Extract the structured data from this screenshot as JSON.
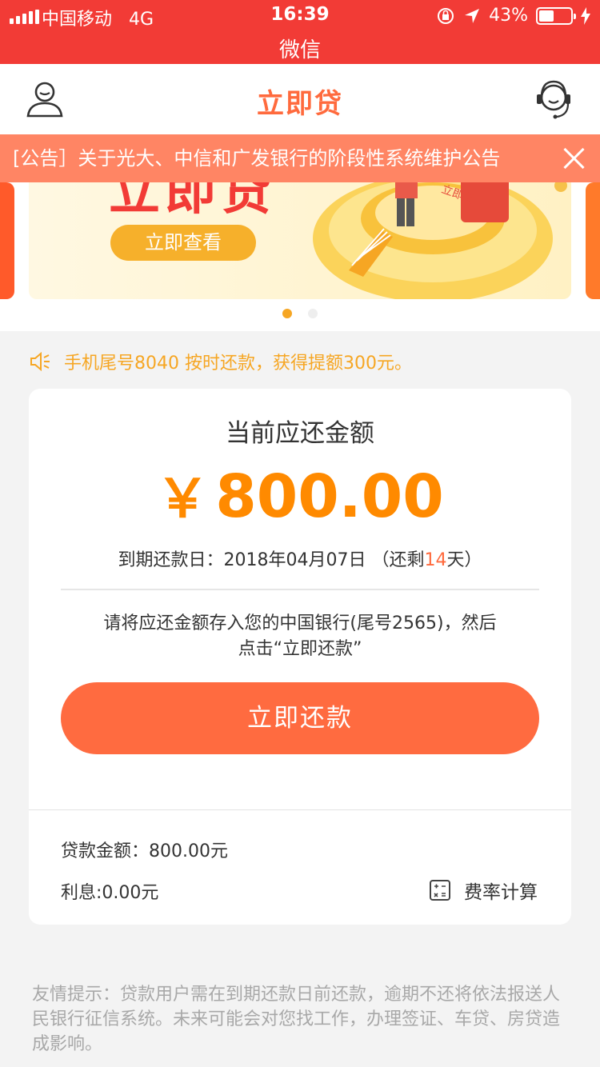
{
  "status_bar": {
    "carrier": "中国移动",
    "network": "4G",
    "time": "16:39",
    "battery": "43%",
    "battery_level": 0.43,
    "subtitle": "微信"
  },
  "header": {
    "title": "立即贷",
    "user_icon": "user-icon",
    "service_icon": "customer-service-icon"
  },
  "notice": {
    "text": "[公告］关于光大、中信和广发银行的阶段性系统维护公告",
    "close_icon": "close-icon"
  },
  "banner": {
    "title": "立即贷",
    "button": "立即查看",
    "art_label": "立即贷",
    "active_dot": 0,
    "dot_count": 2
  },
  "marquee": {
    "icon": "speaker-icon",
    "text": "手机尾号8040 按时还款，获得提额300元。"
  },
  "repayment": {
    "label": "当前应还金额",
    "currency": "￥",
    "amount": "800.00",
    "due_prefix": "到期还款日：2018年04月07日 （还剩",
    "days_left": "14",
    "due_suffix": "天）",
    "instruction_line1": "请将应还金额存入您的中国银行(尾号2565)，然后",
    "instruction_line2": "点击“立即还款”",
    "pay_button": "立即还款",
    "loan_amount": "贷款金额：800.00元",
    "interest": "利息:0.00元",
    "calc_icon": "calculator-icon",
    "calc_label": "费率计算"
  },
  "tip": {
    "text": "友情提示：贷款用户需在到期还款日前还款，逾期不还将依法报送人民银行征信系统。未来可能会对您找工作，办理签证、车贷、房贷造成影响。"
  },
  "colors": {
    "status_bg": "#f23b36",
    "brand": "#ff6a3d",
    "amount": "#ff8a00",
    "notice_bg": "#ff8564",
    "marquee": "#f6a623",
    "pay_button": "#ff6b40"
  }
}
